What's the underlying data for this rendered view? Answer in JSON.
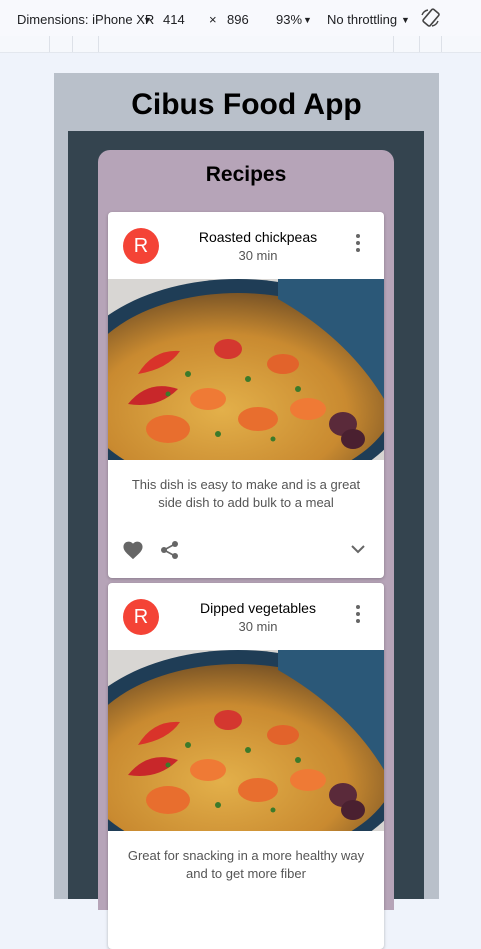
{
  "devtools": {
    "device_label": "Dimensions: iPhone XR",
    "width": "414",
    "times": "×",
    "height": "896",
    "zoom": "93%",
    "throttling": "No throttling",
    "dropdown_caret": "▼"
  },
  "app": {
    "title": "Cibus Food App",
    "panel_title": "Recipes",
    "recipes": [
      {
        "avatar_letter": "R",
        "title": "Roasted chickpeas",
        "time": "30 min",
        "description": "This dish is easy to make and is a great side dish to add bulk to a meal"
      },
      {
        "avatar_letter": "R",
        "title": "Dipped vegetables",
        "time": "30 min",
        "description": "Great for snacking in a more healthy way and to get more fiber"
      }
    ]
  },
  "colors": {
    "device_bg": "#b9c0ca",
    "app_bg": "#34444f",
    "panel_bg": "#b6a4b8",
    "avatar": "#f44336"
  }
}
